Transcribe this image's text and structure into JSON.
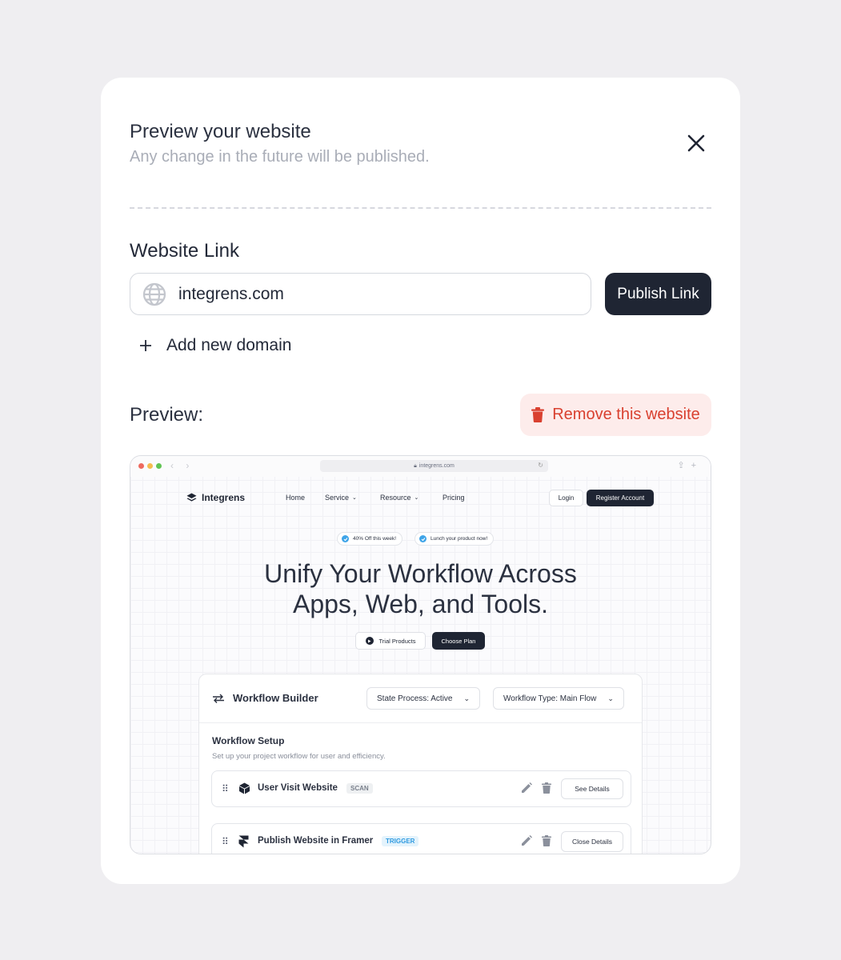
{
  "modal": {
    "title": "Preview your website",
    "subtitle": "Any change in the future will be published.",
    "website_link_label": "Website Link",
    "url_value": "integrens.com",
    "publish_label": "Publish Link",
    "add_domain_label": "Add new domain",
    "preview_label": "Preview:",
    "remove_label": "Remove this website"
  },
  "browser": {
    "address": "integrens.com",
    "site": {
      "brand": "Integrens",
      "nav": {
        "home": "Home",
        "service": "Service",
        "resource": "Resource",
        "pricing": "Pricing"
      },
      "login": "Login",
      "register": "Register Account",
      "pills": [
        "40% Off this week!",
        "Lunch your product now!"
      ],
      "hero_line1": "Unify Your Workflow Across",
      "hero_line2": "Apps, Web, and Tools.",
      "trial": "Trial Products",
      "choose_plan": "Choose Plan",
      "workflow": {
        "title": "Workflow Builder",
        "state_select": "State Process: Active",
        "type_select": "Workflow Type: Main Flow",
        "setup_title": "Workflow Setup",
        "setup_subtitle": "Set up your project workflow for user and efficiency.",
        "rows": [
          {
            "title": "User Visit Website",
            "tag": "SCAN",
            "action": "See Details"
          },
          {
            "title": "Publish Website in Framer",
            "tag": "TRIGGER",
            "action": "Close Details"
          }
        ]
      }
    }
  },
  "colors": {
    "primary_dark": "#1f2533",
    "danger": "#d9402f",
    "danger_bg": "#fdeceb",
    "accent_blue": "#3ea4e8"
  }
}
